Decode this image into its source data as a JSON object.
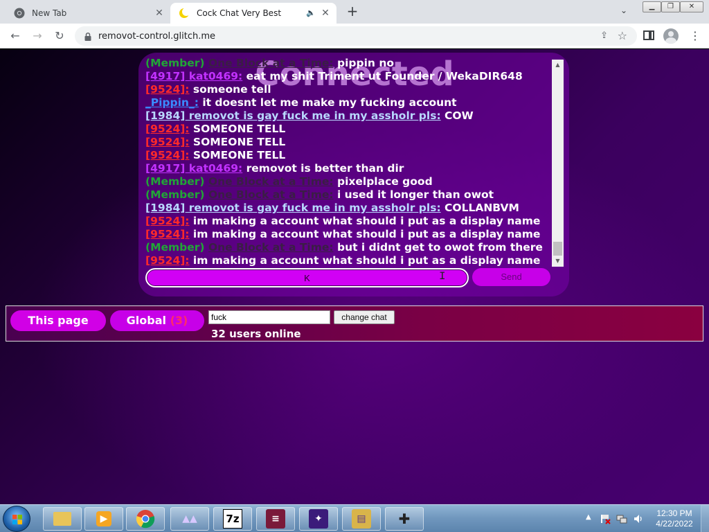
{
  "browser": {
    "tabs": [
      {
        "title": "New Tab",
        "icon": "chrome-icon"
      },
      {
        "title": "Cock Chat Very Best",
        "icon": "moon-icon"
      }
    ],
    "new_tab_label": "+",
    "tab_dropdown": "⌄",
    "url": "removot-control.glitch.me",
    "window_buttons": {
      "minimize": "▁",
      "maximize": "❐",
      "close": "✕"
    }
  },
  "page": {
    "title": "Connected",
    "messages": [
      {
        "rank": "(Member) ",
        "user": "One Block at a Time:",
        "style": "block",
        "text": " pippin no"
      },
      {
        "rank": "",
        "user": "[4917] kat0469:",
        "style": "kat",
        "text": " eat my shit Triment ut Founder / WekaDIR648"
      },
      {
        "rank": "",
        "user": "[9524]:",
        "style": "red",
        "text": " someone tell"
      },
      {
        "rank": "",
        "user": "_Pippin_:",
        "style": "pippin",
        "text": " it doesnt let me make my fucking account"
      },
      {
        "rank": "",
        "user": "[1984] removot is gay fuck me in my assholr pls:",
        "style": "rem",
        "text": " COW"
      },
      {
        "rank": "",
        "user": "[9524]:",
        "style": "red",
        "text": " SOMEONE TELL"
      },
      {
        "rank": "",
        "user": "[9524]:",
        "style": "red",
        "text": " SOMEONE TELL"
      },
      {
        "rank": "",
        "user": "[9524]:",
        "style": "red",
        "text": " SOMEONE TELL"
      },
      {
        "rank": "",
        "user": "[4917] kat0469:",
        "style": "kat",
        "text": " removot is better than dir"
      },
      {
        "rank": "(Member) ",
        "user": "One Block at a Time:",
        "style": "block",
        "text": " pixelplace good"
      },
      {
        "rank": "(Member) ",
        "user": "One Block at a Time:",
        "style": "block",
        "text": " i used it longer than owot"
      },
      {
        "rank": "",
        "user": "[1984] removot is gay fuck me in my assholr pls:",
        "style": "rem",
        "text": " COLLANBVM"
      },
      {
        "rank": "",
        "user": "[9524]:",
        "style": "red",
        "text": " im making a account what should i put as a display name"
      },
      {
        "rank": "",
        "user": "[9524]:",
        "style": "red",
        "text": " im making a account what should i put as a display name"
      },
      {
        "rank": "(Member) ",
        "user": "One Block at a Time:",
        "style": "block",
        "text": " but i didnt get to owot from there"
      },
      {
        "rank": "",
        "user": "[9524]:",
        "style": "red",
        "text": " im making a account what should i put as a display name"
      }
    ],
    "chat_input_value": "K",
    "send_label": "Send",
    "this_page_label": "This page",
    "global_label": "Global ",
    "global_count": "(3)",
    "chat_name_value": "fuck",
    "change_chat_label": "change chat",
    "users_online": "32 users online"
  },
  "taskbar": {
    "time": "12:30 PM",
    "date": "4/22/2022",
    "apps": [
      "explorer-icon",
      "media-player-icon",
      "chrome-icon",
      "app-triangles-icon",
      "7zip-icon",
      "editor-icon",
      "game-icon",
      "archive-icon",
      "gamepad-icon"
    ],
    "sevenzip_label": "7z"
  },
  "colors": {
    "accent_magenta": "#d100f5",
    "member_green": "#21a637",
    "user_red": "#ff2a2a",
    "user_purple": "#c232ff"
  }
}
